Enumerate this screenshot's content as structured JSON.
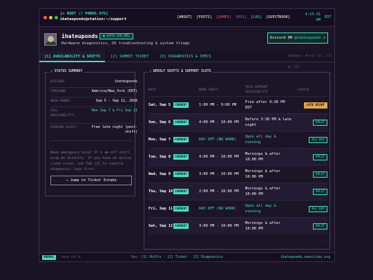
{
  "header": {
    "brand_line1": "[+ ROOT // PONDS.SYS]",
    "user": "ihateuponds",
    "host_path": "@station:~/support",
    "nav": [
      "[ABOUT]",
      "[POSTS]",
      "[GAMES]",
      "[RSS]",
      "[LOG]",
      "[GUESTBOOK]"
    ],
    "nav_colors": [
      "#ffffff",
      "#ffffff",
      "#e0608a",
      "#8c6adb",
      "#3de4c4",
      "#ffffff"
    ],
    "clock_line1": "4:15:31",
    "clock_line2": "AM",
    "tz": "EDT"
  },
  "profile": {
    "name": "ihateuponds",
    "badge": "● OPEN FOR DMS",
    "tagline": "Hardware diagnostics, OS troubleshooting & system triage",
    "discord_prefix": "Discord DM ",
    "discord_handle": "@ihateuponds",
    "discord_suffix": " ↗"
  },
  "tabs": {
    "items": [
      "[1] AVAILABILITY & SHIFTS",
      "[2] SUBMIT TICKET",
      "[3] DIAGNOSTICS & SPECS"
    ],
    "hint": "Hotkeys: Press [1], [2], or [3]"
  },
  "status": {
    "title": "STATUS SUMMARY",
    "rows": [
      {
        "k": "DISCORD:",
        "v": "ihateuponds"
      },
      {
        "k": "TIMEZONE:",
        "v": "America/New_York (EDT)"
      },
      {
        "k": "WEEK RANGE:",
        "v": "Sep 5 - Sep 12, 2026"
      },
      {
        "k": "FULL AVAILABILITY:",
        "v": "Mon Sep 7 & Fri Sep 11"
      },
      {
        "k": "EVENING SLOTS:",
        "v": "Free late night (post-shift)"
      }
    ],
    "help": "Need emergency help? If I am off shift, ping me directly. If you have an active crash issue, use Tab [2] to compile diagnostic logs first.",
    "jump": "→ Jump to Ticket Intake"
  },
  "schedule": {
    "title": "WEEKLY SHIFTS & SUPPORT SLOTS",
    "headers": {
      "date": "DATE",
      "shift": "WORK SHIFT",
      "avail": "TECH SUPPORT AVAILABILITY",
      "status": "STATUS"
    },
    "current_label": "CURRENT",
    "rows": [
      {
        "date": "Sat, Sep 5",
        "shift": "1:00 PM - 9:00 PM",
        "avail": "Free after 9:30 PM EDT",
        "status": "LATE NIGHT",
        "off": false,
        "late": true
      },
      {
        "date": "Sun, Sep 6",
        "shift": "4:00 PM - 10:00 PM",
        "avail": "Before 3:30 PM & late night",
        "status": "SPLIT",
        "off": false,
        "late": false
      },
      {
        "date": "Mon, Sep 7",
        "shift": "DAY OFF (NO WORK)",
        "avail": "Open all day & evening",
        "status": "ALL DAY",
        "off": true,
        "late": false
      },
      {
        "date": "Tue, Sep 8",
        "shift": "4:00 PM - 10:00 PM",
        "avail": "Mornings & after 10:00 PM",
        "status": "SPLIT",
        "off": false,
        "late": false
      },
      {
        "date": "Wed, Sep 9",
        "shift": "3:00 PM - 10:00 PM",
        "avail": "Mornings & after 10:00 PM",
        "status": "SPLIT",
        "off": false,
        "late": false
      },
      {
        "date": "Thu, Sep 10",
        "shift": "2:00 PM - 10:00 PM",
        "avail": "Mornings & after 10:00 PM",
        "status": "SPLIT",
        "off": false,
        "late": false
      },
      {
        "date": "Fri, Sep 11",
        "shift": "DAY OFF (NO WORK)",
        "avail": "Open all day & evening",
        "status": "ALL DAY",
        "off": true,
        "late": false
      },
      {
        "date": "Sat, Sep 12",
        "shift": "3:00 PM - 10:00 PM",
        "avail": "Mornings & after 10:00 PM",
        "status": "SPLIT",
        "off": false,
        "late": false
      }
    ]
  },
  "footer": {
    "mode": "NORMAL",
    "enc": "bash utf-8",
    "nav_prefix": "Nav:",
    "nav_items": [
      "[1] Shifts",
      "[2] Ticket",
      "[3] Diagnostics"
    ],
    "site": "ihateuponds.neocities.org"
  },
  "colors": {
    "accent": "#3de4c4",
    "late": "#e0a64a",
    "bg": "#1a1326"
  }
}
